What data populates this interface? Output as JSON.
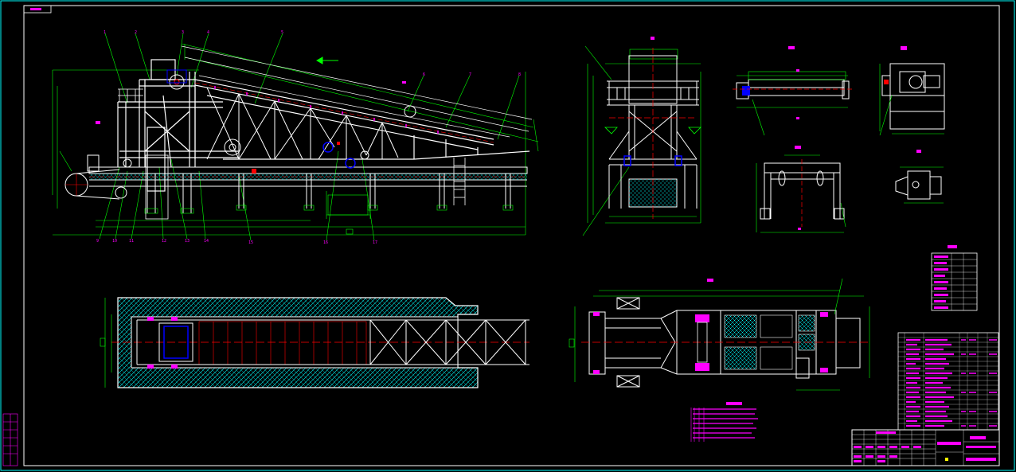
{
  "drawing": {
    "background": "#000000",
    "colors": {
      "frame": "#00ffff",
      "structure": "#ffffff",
      "dimension": "#00ff00",
      "centerline": "#ff0000",
      "text": "#ff00ff",
      "hatch": "#00ffff"
    },
    "views": [
      "side-elevation",
      "end-elevation",
      "detail-roller",
      "detail-drive",
      "detail-bracket",
      "detail-small",
      "plan-view",
      "plan-view-frame"
    ]
  }
}
